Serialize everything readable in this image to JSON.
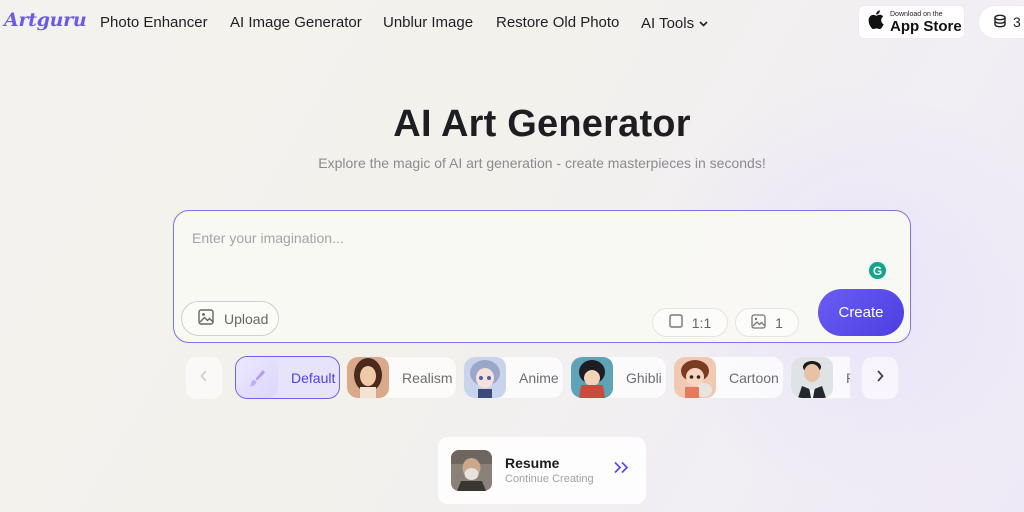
{
  "nav": {
    "logo": "Artguru",
    "links": [
      "Photo Enhancer",
      "AI Image Generator",
      "Unblur Image",
      "Restore Old Photo",
      "AI Tools"
    ],
    "appstore_small": "Download on the",
    "appstore_big": "App Store",
    "credits": "3"
  },
  "hero": {
    "title": "AI Art Generator",
    "subtitle": "Explore the magic of AI art generation - create masterpieces in seconds!"
  },
  "prompt": {
    "placeholder": "Enter your imagination...",
    "upload_label": "Upload",
    "ratio_label": "1:1",
    "count_label": "1",
    "create_label": "Create"
  },
  "styles": {
    "items": [
      {
        "label": "Default",
        "active": true
      },
      {
        "label": "Realism",
        "active": false
      },
      {
        "label": "Anime",
        "active": false
      },
      {
        "label": "Ghibli",
        "active": false
      },
      {
        "label": "Cartoon",
        "active": false
      },
      {
        "label": "P",
        "active": false
      }
    ]
  },
  "resume": {
    "title": "Resume",
    "subtitle": "Continue Creating"
  },
  "colors": {
    "accent": "#5b4ee8",
    "logo": "#6b5ce7",
    "grammarly": "#14a38b"
  }
}
